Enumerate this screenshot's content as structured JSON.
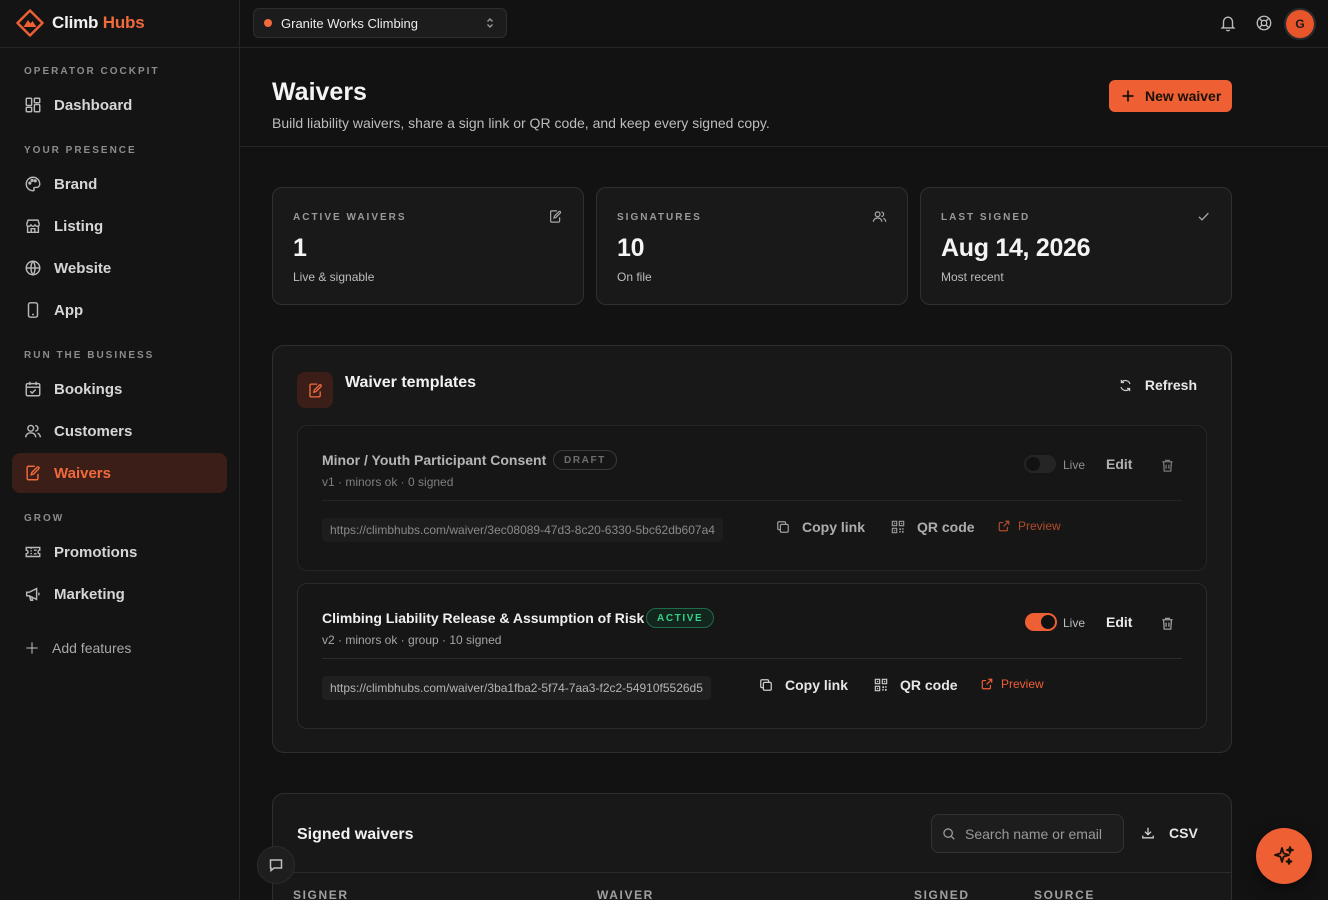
{
  "brand": {
    "name_part1": "Climb",
    "name_part2": "Hubs",
    "accent": "#ee5f34"
  },
  "workspace": {
    "name": "Granite Works Climbing",
    "status_color": "#ee5f34"
  },
  "user": {
    "initial": "G"
  },
  "sidebar": {
    "sections": [
      {
        "label": "OPERATOR COCKPIT"
      },
      {
        "label": "YOUR PRESENCE"
      },
      {
        "label": "RUN THE BUSINESS"
      },
      {
        "label": "GROW"
      }
    ],
    "items": [
      {
        "label": "Dashboard",
        "icon": "grid-icon"
      },
      {
        "label": "Brand",
        "icon": "palette-icon"
      },
      {
        "label": "Listing",
        "icon": "store-icon"
      },
      {
        "label": "Website",
        "icon": "globe-icon"
      },
      {
        "label": "App",
        "icon": "phone-icon"
      },
      {
        "label": "Bookings",
        "icon": "calendar-check-icon"
      },
      {
        "label": "Customers",
        "icon": "users-icon"
      },
      {
        "label": "Waivers",
        "icon": "edit-document-icon",
        "active": true
      },
      {
        "label": "Promotions",
        "icon": "ticket-icon"
      },
      {
        "label": "Marketing",
        "icon": "megaphone-icon"
      }
    ],
    "add_features": "Add features"
  },
  "header": {
    "title": "Waivers",
    "subtitle": "Build liability waivers, share a sign link or QR code, and keep every signed copy.",
    "new_button": "New waiver"
  },
  "stats": [
    {
      "label": "ACTIVE WAIVERS",
      "value": "1",
      "note": "Live & signable",
      "icon": "edit-document-icon"
    },
    {
      "label": "SIGNATURES",
      "value": "10",
      "note": "On file",
      "icon": "users-icon"
    },
    {
      "label": "LAST SIGNED",
      "value": "Aug 14, 2026",
      "note": "Most recent",
      "icon": "check-icon"
    }
  ],
  "templates_panel": {
    "title": "Waiver templates",
    "refresh_label": "Refresh",
    "templates": [
      {
        "name": "Minor / Youth Participant Consent",
        "status": "DRAFT",
        "meta": "v1 · minors ok · 0 signed",
        "live": false,
        "live_label": "Live",
        "edit_label": "Edit",
        "url": "https://climbhubs.com/waiver/3ec08089-47d3-8c20-6330-5bc62db607a4",
        "copy_label": "Copy link",
        "qr_label": "QR code",
        "preview_label": "Preview"
      },
      {
        "name": "Climbing Liability Release & Assumption of Risk",
        "status": "ACTIVE",
        "meta": "v2 · minors ok · group · 10 signed",
        "live": true,
        "live_label": "Live",
        "edit_label": "Edit",
        "url": "https://climbhubs.com/waiver/3ba1fba2-5f74-7aa3-f2c2-54910f5526d5",
        "copy_label": "Copy link",
        "qr_label": "QR code",
        "preview_label": "Preview"
      }
    ]
  },
  "signed_panel": {
    "title": "Signed waivers",
    "search_placeholder": "Search name or email",
    "csv_label": "CSV",
    "columns": [
      "SIGNER",
      "WAIVER",
      "SIGNED",
      "SOURCE"
    ]
  }
}
